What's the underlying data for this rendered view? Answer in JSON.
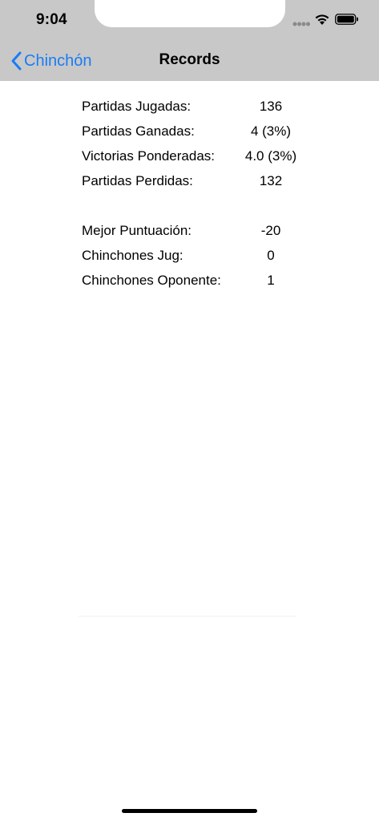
{
  "status_bar": {
    "time": "9:04",
    "icons": [
      "signal-dots-icon",
      "wifi-icon",
      "battery-icon"
    ]
  },
  "nav": {
    "back_label": "Chinchón",
    "title": "Records",
    "accent_color": "#1a7cf5",
    "bar_color": "#c8c8c8"
  },
  "stats": [
    {
      "label": "Partidas Jugadas:",
      "value": "136"
    },
    {
      "label": "Partidas Ganadas:",
      "value": "4 (3%)"
    },
    {
      "label": "Victorias Ponderadas:",
      "value": "4.0 (3%)"
    },
    {
      "label": "Partidas Perdidas:",
      "value": "132"
    },
    {
      "label": "Mejor Puntuación:",
      "value": "-20"
    },
    {
      "label": "Chinchones Jug:",
      "value": "0"
    },
    {
      "label": "Chinchones Oponente:",
      "value": "1"
    }
  ]
}
